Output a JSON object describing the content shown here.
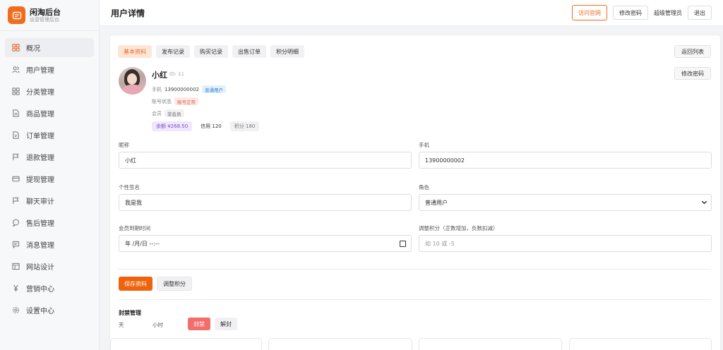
{
  "brand": {
    "title": "闲淘后台",
    "subtitle": "运营管理后台",
    "color": "#f36b1c"
  },
  "sidebar": {
    "items": [
      {
        "label": "概况",
        "icon": "grid-icon"
      },
      {
        "label": "用户管理",
        "icon": "users-icon"
      },
      {
        "label": "分类管理",
        "icon": "category-icon"
      },
      {
        "label": "商品管理",
        "icon": "document-icon"
      },
      {
        "label": "订单管理",
        "icon": "order-icon"
      },
      {
        "label": "退款管理",
        "icon": "flag-icon"
      },
      {
        "label": "提现管理",
        "icon": "card-icon"
      },
      {
        "label": "聊天审计",
        "icon": "flag-icon"
      },
      {
        "label": "售后管理",
        "icon": "chat-icon"
      },
      {
        "label": "消息管理",
        "icon": "message-icon"
      },
      {
        "label": "网站设计",
        "icon": "layout-icon"
      },
      {
        "label": "营销中心",
        "icon": "yen-icon"
      },
      {
        "label": "设置中心",
        "icon": "gear-icon"
      }
    ]
  },
  "header": {
    "title": "用户详情",
    "visit_site": "访问官网",
    "change_password": "修改密码",
    "role": "超级管理员",
    "logout": "退出"
  },
  "tabs": [
    "基本资料",
    "发布记录",
    "购买记录",
    "出售订单",
    "积分明细"
  ],
  "back_button": "返回列表",
  "user": {
    "name": "小红",
    "id_text": "ID: 11",
    "phone_label": "手机",
    "phone": "13900000002",
    "role_badge": "普通用户",
    "status_label": "账号状态",
    "status": "账号正常",
    "member_label": "会员",
    "member": "非会员",
    "balance": "余额 ¥268.50",
    "credit": "信用 120",
    "points": "积分 180",
    "change_password": "修改密码"
  },
  "form": {
    "nickname_label": "昵称",
    "nickname": "小红",
    "phone_label": "手机",
    "phone": "13900000002",
    "signature_label": "个性签名",
    "signature": "我是我",
    "role_label": "角色",
    "role": "普通用户",
    "member_expire_label": "会员到期时间",
    "member_expire_placeholder": "年 /月/日 --:--",
    "adjust_points_label": "调整积分（正数增加，负数扣减）",
    "adjust_points_placeholder": "如 10 或 -5"
  },
  "actions": {
    "save": "保存资料",
    "adjust_points": "调整积分"
  },
  "ban": {
    "title": "封禁管理",
    "day_label": "天",
    "hour_label": "小时",
    "ban_button": "封禁",
    "unban_button": "解封"
  }
}
